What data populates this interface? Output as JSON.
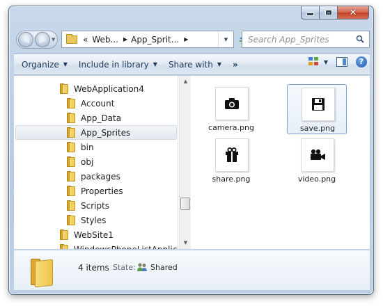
{
  "window": {
    "caption": {
      "minimize": "minimize",
      "maximize": "maximize",
      "close": "✕"
    }
  },
  "address": {
    "prefix": "«",
    "crumbs": [
      "Web...",
      "App_Sprit..."
    ],
    "separator": "▶",
    "dropdown": "▼",
    "refresh": "↻"
  },
  "nav": {
    "back": "◀",
    "forward": "▶",
    "history_dropdown": "▼"
  },
  "search": {
    "placeholder": "Search App_Sprites",
    "value": ""
  },
  "commandbar": {
    "organize": "Organize",
    "include_in_library": "Include in library",
    "share_with": "Share with",
    "more": "»",
    "dropdown_arrow": "▼",
    "help": "?"
  },
  "tree": {
    "items": [
      {
        "label": "WebApplication4",
        "level": 1,
        "selected": false
      },
      {
        "label": "Account",
        "level": 2,
        "selected": false
      },
      {
        "label": "App_Data",
        "level": 2,
        "selected": false
      },
      {
        "label": "App_Sprites",
        "level": 2,
        "selected": true
      },
      {
        "label": "bin",
        "level": 2,
        "selected": false
      },
      {
        "label": "obj",
        "level": 2,
        "selected": false
      },
      {
        "label": "packages",
        "level": 2,
        "selected": false
      },
      {
        "label": "Properties",
        "level": 2,
        "selected": false
      },
      {
        "label": "Scripts",
        "level": 2,
        "selected": false
      },
      {
        "label": "Styles",
        "level": 2,
        "selected": false
      },
      {
        "label": "WebSite1",
        "level": 1,
        "selected": false
      },
      {
        "label": "WindowsPhoneListApplica",
        "level": 1,
        "selected": false
      }
    ]
  },
  "scrollbar": {
    "up": "▲",
    "down": "▼"
  },
  "files": [
    {
      "name": "camera.png",
      "icon": "camera-icon",
      "selected": false
    },
    {
      "name": "save.png",
      "icon": "floppy-disk-icon",
      "selected": true
    },
    {
      "name": "share.png",
      "icon": "gift-icon",
      "selected": false
    },
    {
      "name": "video.png",
      "icon": "video-camera-icon",
      "selected": false
    }
  ],
  "details": {
    "count": "4 items",
    "state_label": "State:",
    "state_value": "Shared",
    "state_icon": "users-icon"
  },
  "colors": {
    "chrome": "#c9d8ea",
    "command_text": "#1e395b",
    "selection_border": "#7da2ce",
    "folder": "#efc84e"
  }
}
